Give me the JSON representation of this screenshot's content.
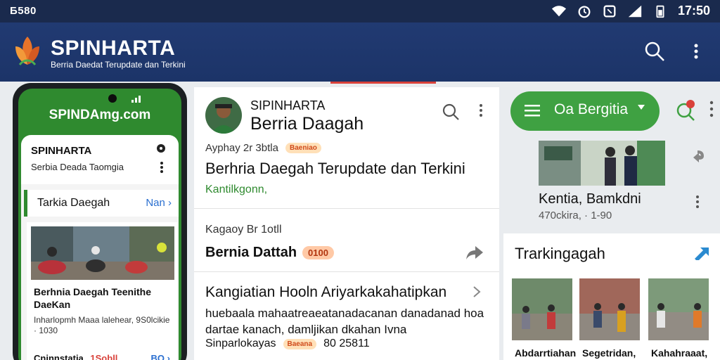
{
  "status_bar": {
    "left_text": "Ƃ580",
    "time": "17:50"
  },
  "app_header": {
    "brand": "SPINHARTA",
    "tagline": "Berria Daedat Terupdate dan Terkini"
  },
  "phone": {
    "title": "SPINDAmg.com",
    "card_title": "SPINHARTA",
    "card_subtitle": "Serbia Deada Taomgia",
    "section_label": "Tarkia Daegah",
    "section_link": "Nan ›",
    "story_headline": "Berhnia Daegah Teenithe DaeKan",
    "story_desc": "Inharlopmh Maaa lalehear, 9S0lcikie · 1030",
    "footer_label": "Cninnstatia,",
    "footer_red": "1Sobll",
    "footer_link": "BO ›"
  },
  "main_feed": {
    "author_line1": "SIPINHARTA",
    "author_line2": "Berria Daagah",
    "meta1": "Ayphay 2r 3btla",
    "meta1_badge": "Baeniao",
    "headline": "Berhria Daegah Terupdate dan Terkini",
    "green_text": "Kantilkgonn,",
    "meta2": "Kagaoy Br 1otll",
    "story_title": "Bernia Dattah",
    "story_badge": "0100",
    "card2_title": "Kangiatian Hooln Ariyarkakahatipkan",
    "card2_body": "huebaala mahaatreaeatanadacanan danadanad hoa dartae kanach, damljikan dkahan Ivna",
    "card2_foot": "Sinparlokayas",
    "card2_badge": "Baeana",
    "card2_foot_num": "80 25811"
  },
  "right_panel": {
    "pill_label": "Oa Bergitia",
    "story_title": "Kentia, Bamkdni",
    "story_meta": "470ckira, · 1-90",
    "box_title": "Trarkingagah",
    "thumbs": [
      "Abdarrtiahan",
      "Segetridan,",
      "Kahahraaat,"
    ]
  },
  "colors": {
    "header": "#213a72",
    "green": "#3fa142",
    "accent_red": "#d9413a",
    "link_blue": "#2a6fd0"
  }
}
